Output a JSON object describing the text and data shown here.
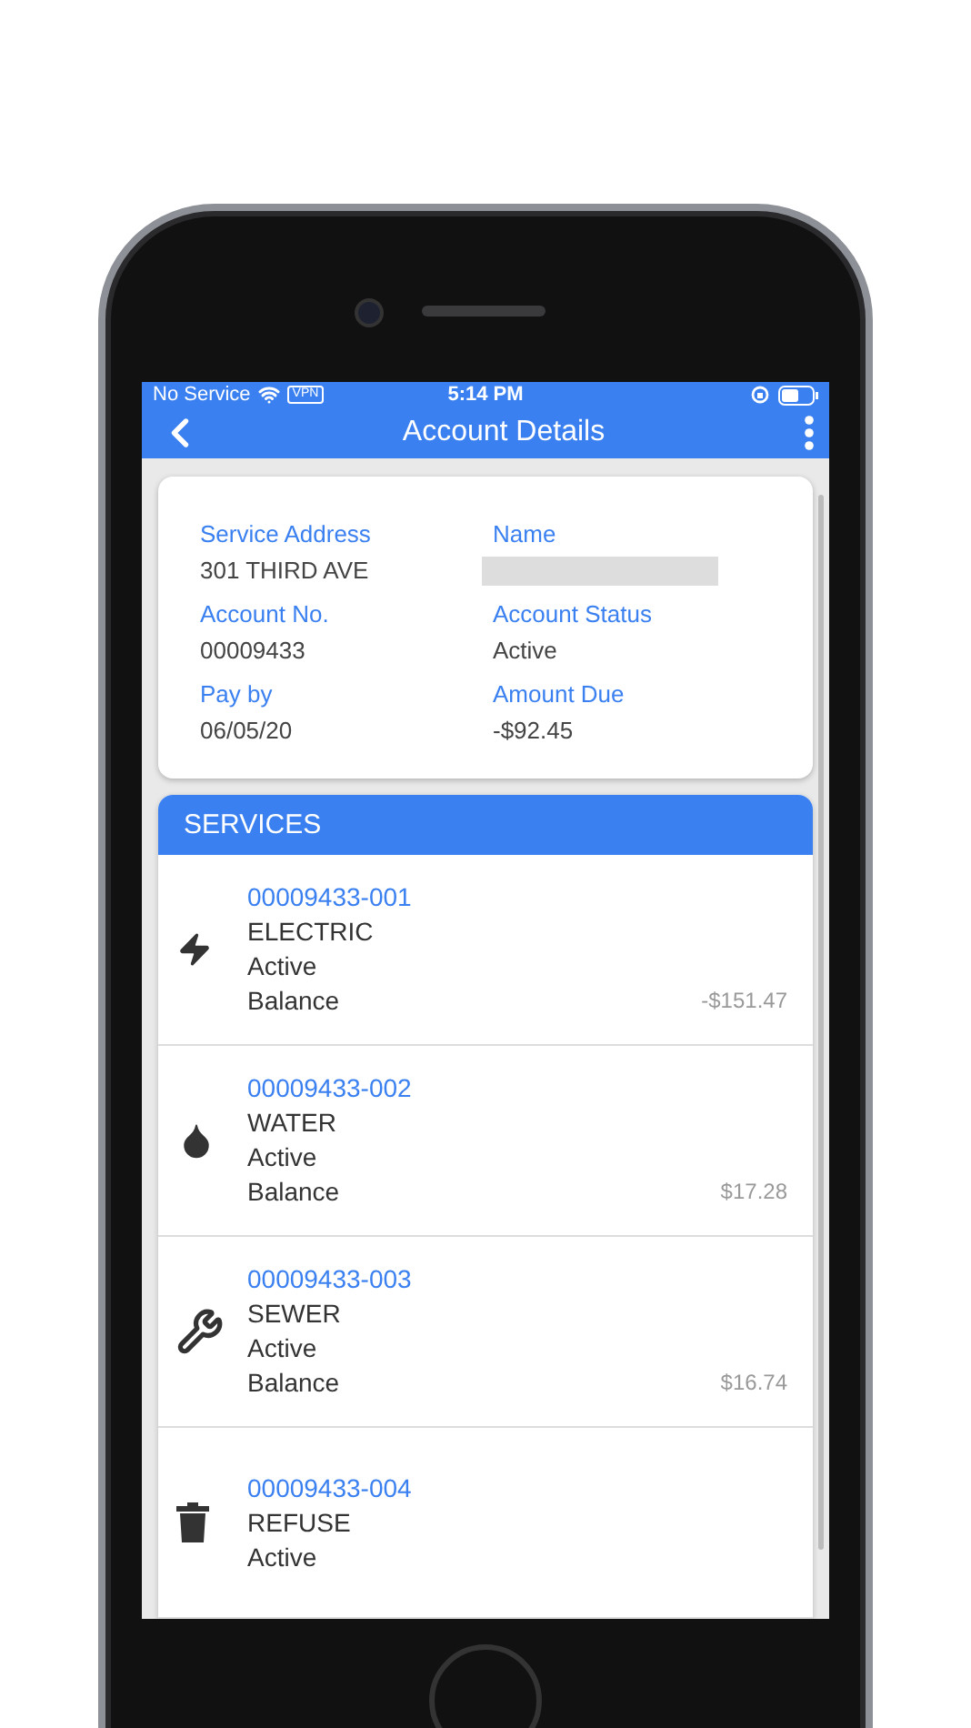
{
  "status_bar": {
    "carrier": "No Service",
    "vpn": "VPN",
    "time": "5:14 PM"
  },
  "nav": {
    "title": "Account Details"
  },
  "account": [
    {
      "kind": "text",
      "label": "Service Address",
      "value": "301 THIRD AVE"
    },
    {
      "kind": "redacted",
      "label": "Name"
    },
    {
      "kind": "text",
      "label": "Account No.",
      "value": "00009433"
    },
    {
      "kind": "text",
      "label": "Account Status",
      "value": "Active"
    },
    {
      "kind": "text",
      "label": "Pay by",
      "value": "06/05/20"
    },
    {
      "kind": "text",
      "label": "Amount Due",
      "value": "-$92.45"
    }
  ],
  "services": {
    "title": "SERVICES",
    "items": [
      {
        "kind": "electric",
        "number": "00009433-001",
        "type": "ELECTRIC",
        "status": "Active",
        "balance_label": "Balance",
        "balance": "-$151.47"
      },
      {
        "kind": "water",
        "number": "00009433-002",
        "type": "WATER",
        "status": "Active",
        "balance_label": "Balance",
        "balance": "$17.28"
      },
      {
        "kind": "sewer",
        "number": "00009433-003",
        "type": "SEWER",
        "status": "Active",
        "balance_label": "Balance",
        "balance": "$16.74"
      },
      {
        "kind": "refuse",
        "number": "00009433-004",
        "type": "REFUSE",
        "status": "Active"
      }
    ]
  }
}
